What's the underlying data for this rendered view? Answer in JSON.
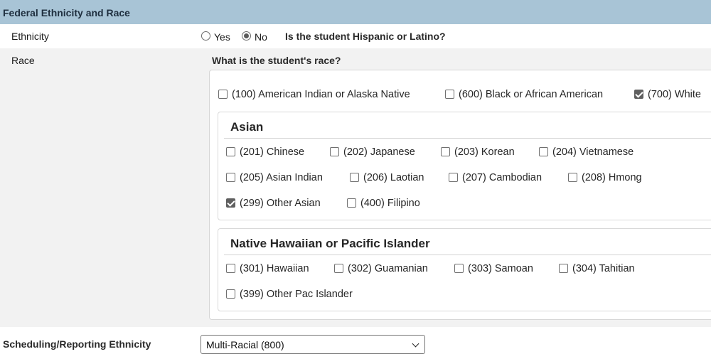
{
  "section": {
    "title": "Federal Ethnicity and Race"
  },
  "ethnicity": {
    "label": "Ethnicity",
    "yes_label": "Yes",
    "no_label": "No",
    "selected": "No",
    "question": "Is the student Hispanic or Latino?"
  },
  "race": {
    "label": "Race",
    "question": "What is the student's race?",
    "top_options": [
      {
        "label": "(100) American Indian or Alaska Native",
        "checked": false
      },
      {
        "label": "(600) Black or African American",
        "checked": false
      },
      {
        "label": "(700) White",
        "checked": true
      }
    ],
    "asian": {
      "title": "Asian",
      "options": [
        {
          "label": "(201) Chinese",
          "checked": false
        },
        {
          "label": "(202) Japanese",
          "checked": false
        },
        {
          "label": "(203) Korean",
          "checked": false
        },
        {
          "label": "(204) Vietnamese",
          "checked": false
        },
        {
          "label": "(205) Asian Indian",
          "checked": false
        },
        {
          "label": "(206) Laotian",
          "checked": false
        },
        {
          "label": "(207) Cambodian",
          "checked": false
        },
        {
          "label": "(208) Hmong",
          "checked": false
        },
        {
          "label": "(299) Other Asian",
          "checked": true
        },
        {
          "label": "(400) Filipino",
          "checked": false
        }
      ]
    },
    "pacific": {
      "title": "Native Hawaiian or Pacific Islander",
      "options": [
        {
          "label": "(301) Hawaiian",
          "checked": false
        },
        {
          "label": "(302) Guamanian",
          "checked": false
        },
        {
          "label": "(303) Samoan",
          "checked": false
        },
        {
          "label": "(304) Tahitian",
          "checked": false
        },
        {
          "label": "(399) Other Pac Islander",
          "checked": false
        }
      ]
    }
  },
  "scheduling": {
    "label": "Scheduling/Reporting Ethnicity",
    "selected_value": "Multi-Racial (800)"
  },
  "colors": {
    "header_bg": "#a8c4d6",
    "row_alt_bg": "#f2f2f2",
    "checked_fill": "#5f5f5f"
  }
}
